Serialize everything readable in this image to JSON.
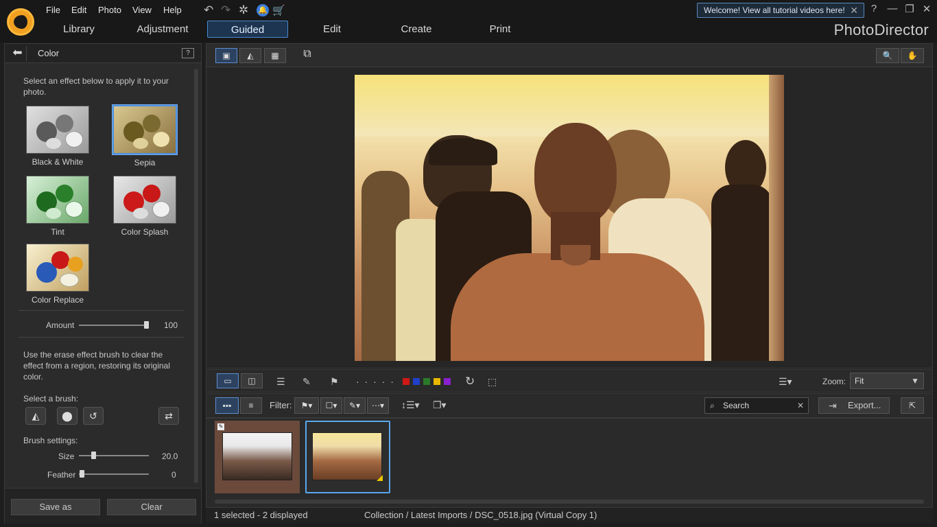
{
  "app": {
    "brand": "PhotoDirector",
    "menu": [
      "File",
      "Edit",
      "Photo",
      "View",
      "Help"
    ],
    "tabs": [
      "Library",
      "Adjustment",
      "Guided",
      "Edit",
      "Create",
      "Print"
    ],
    "active_tab": "Guided",
    "welcome": "Welcome! View all tutorial videos here!",
    "window_controls": {
      "help": "?",
      "minimize": "—",
      "restore": "❐",
      "close": "✕"
    },
    "toolbar_icons": [
      "undo-icon",
      "redo-icon",
      "settings-icon",
      "notification-icon",
      "cart-icon"
    ]
  },
  "left_panel": {
    "title": "Color",
    "help_label": "?",
    "intro": "Select an effect below to apply it to your photo.",
    "effects": [
      {
        "label": "Black & White",
        "selected": false
      },
      {
        "label": "Sepia",
        "selected": true
      },
      {
        "label": "Tint",
        "selected": false
      },
      {
        "label": "Color Splash",
        "selected": false
      },
      {
        "label": "Color Replace",
        "selected": false
      }
    ],
    "amount": {
      "label": "Amount",
      "value": "100",
      "level": 1.0
    },
    "erase_text": "Use the erase effect brush to clear the effect from a region, restoring its original color.",
    "brush_label": "Select a brush:",
    "brush_settings_label": "Brush settings:",
    "size": {
      "label": "Size",
      "value": "20.0",
      "level": 0.2
    },
    "feather": {
      "label": "Feather",
      "value": "0",
      "level": 0.0
    },
    "save_label": "Save as",
    "clear_label": "Clear"
  },
  "viewer": {
    "icons": [
      "single-view-icon",
      "compare-view-icon",
      "grid-view-icon",
      "second-display-icon",
      "zoom-icon",
      "hand-tool-icon"
    ]
  },
  "strip_toolbar": {
    "color_labels": [
      "#d01818",
      "#2040c8",
      "#2a7a2a",
      "#e8b800",
      "#8a20d0"
    ],
    "zoom_label": "Zoom:",
    "zoom_value": "Fit",
    "rating_dots": "· · · · ·"
  },
  "filmbar": {
    "filter_label": "Filter:",
    "search_placeholder": "Search",
    "export_label": "Export..."
  },
  "status": {
    "selection": "1 selected - 2 displayed",
    "path": "Collection / Latest Imports / DSC_0518.jpg (Virtual Copy 1)"
  }
}
